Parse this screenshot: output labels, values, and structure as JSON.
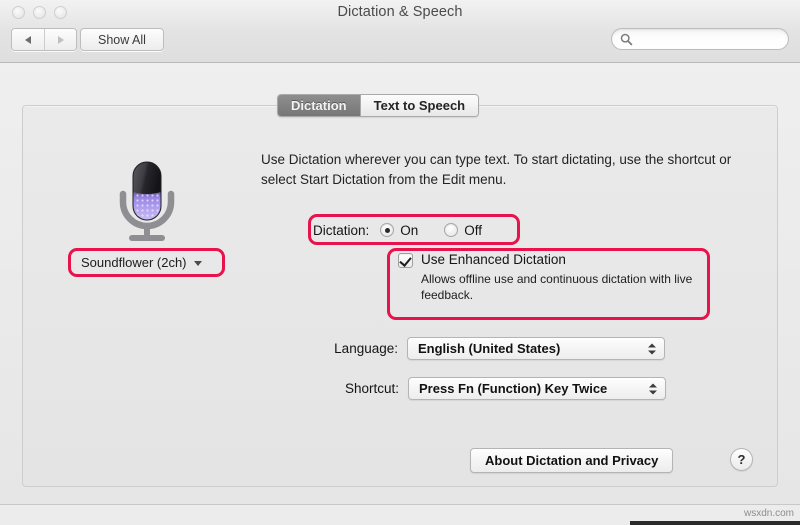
{
  "window": {
    "title": "Dictation & Speech",
    "traffic_lights": [
      "close-button",
      "minimize-button",
      "zoom-button"
    ],
    "toolbar": {
      "back_label": "◀",
      "forward_label": "▶",
      "show_all_label": "Show All",
      "search": {
        "value": "",
        "placeholder": "",
        "icon": "search-icon"
      }
    }
  },
  "tabs": [
    {
      "label": "Dictation",
      "active": true
    },
    {
      "label": "Text to Speech",
      "active": false
    }
  ],
  "main": {
    "description": "Use Dictation wherever you can type text. To start dictating, use the shortcut or select Start Dictation from the Edit menu.",
    "mic_icon": "microphone-icon",
    "input_source": {
      "label": "Soundflower (2ch)",
      "caret": "chevron-down-icon"
    },
    "dictation": {
      "label": "Dictation:",
      "options": [
        {
          "label": "On",
          "selected": true
        },
        {
          "label": "Off",
          "selected": false
        }
      ]
    },
    "enhanced_dictation": {
      "label": "Use Enhanced Dictation",
      "checked": true,
      "description": "Allows offline use and continuous dictation with live feedback."
    },
    "language": {
      "label": "Language:",
      "value": "English (United States)"
    },
    "shortcut": {
      "label": "Shortcut:",
      "value": "Press Fn (Function) Key Twice"
    },
    "about_button": "About Dictation and Privacy",
    "help_button": "?"
  },
  "annotations": {
    "color": "#e8124c",
    "boxes": [
      "dictation-row",
      "input-source-popup",
      "enhanced-dictation-group"
    ]
  },
  "footer": {
    "watermark": "wsxdn.com"
  }
}
